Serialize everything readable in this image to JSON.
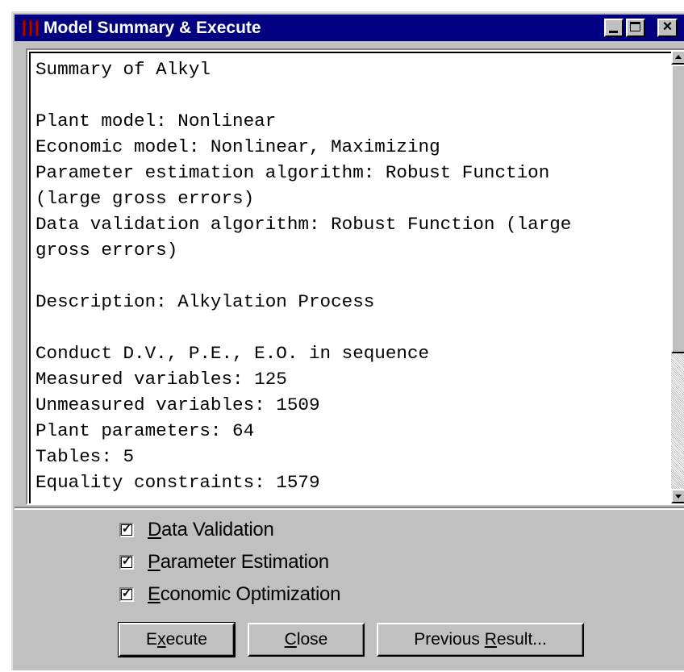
{
  "window": {
    "title": "Model Summary & Execute",
    "icon": "app-bars-icon"
  },
  "summary": {
    "lines": [
      "Summary of Alkyl",
      "",
      "Plant model: Nonlinear",
      "Economic model: Nonlinear, Maximizing",
      "Parameter estimation algorithm: Robust Function",
      "(large gross errors)",
      "Data validation algorithm: Robust Function (large",
      "gross errors)",
      "",
      "Description: Alkylation Process",
      "",
      "Conduct D.V., P.E., E.O. in sequence",
      "Measured variables: 125",
      "Unmeasured variables: 1509",
      "Plant parameters: 64",
      "Tables: 5",
      "Equality constraints: 1579"
    ]
  },
  "options": [
    {
      "mnemonic": "D",
      "rest": "ata Validation",
      "checked": true
    },
    {
      "mnemonic": "P",
      "rest": "arameter Estimation",
      "checked": true
    },
    {
      "mnemonic": "E",
      "rest": "conomic Optimization",
      "checked": true
    }
  ],
  "buttons": {
    "execute": {
      "pre": "E",
      "mnemonic": "x",
      "post": "ecute"
    },
    "close": {
      "pre": "",
      "mnemonic": "C",
      "post": "lose"
    },
    "previous": {
      "pre": "Previous ",
      "mnemonic": "R",
      "post": "esult..."
    }
  },
  "colors": {
    "titlebar": "#000080",
    "face": "#c0c0c0"
  }
}
